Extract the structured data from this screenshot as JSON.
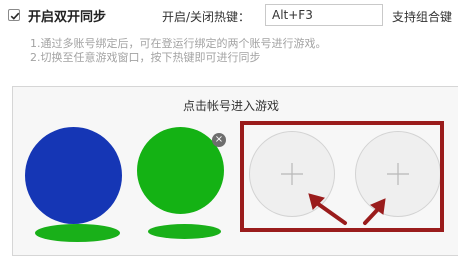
{
  "header": {
    "checkbox_label": "开启双开同步",
    "checked": true,
    "hotkey_label": "开启/关闭热键：",
    "hotkey_value": "Alt+F3",
    "combo_text": "支持组合键"
  },
  "hints": [
    "1.通过多账号绑定后，可在登运行绑定的两个账号进行游戏。",
    "2.切换至任意游戏窗口，按下热键即可进行同步"
  ],
  "panel": {
    "title": "点击帐号进入游戏"
  },
  "accounts": [
    {
      "color": "#1536b5",
      "shadow_color": "#19b019"
    },
    {
      "color": "#14b214",
      "shadow_color": "#19b019",
      "badge": "×"
    }
  ],
  "slots": [
    {
      "icon": "plus-icon"
    },
    {
      "icon": "plus-icon"
    }
  ],
  "annotation": {
    "frame_color": "#9a1c1c"
  }
}
